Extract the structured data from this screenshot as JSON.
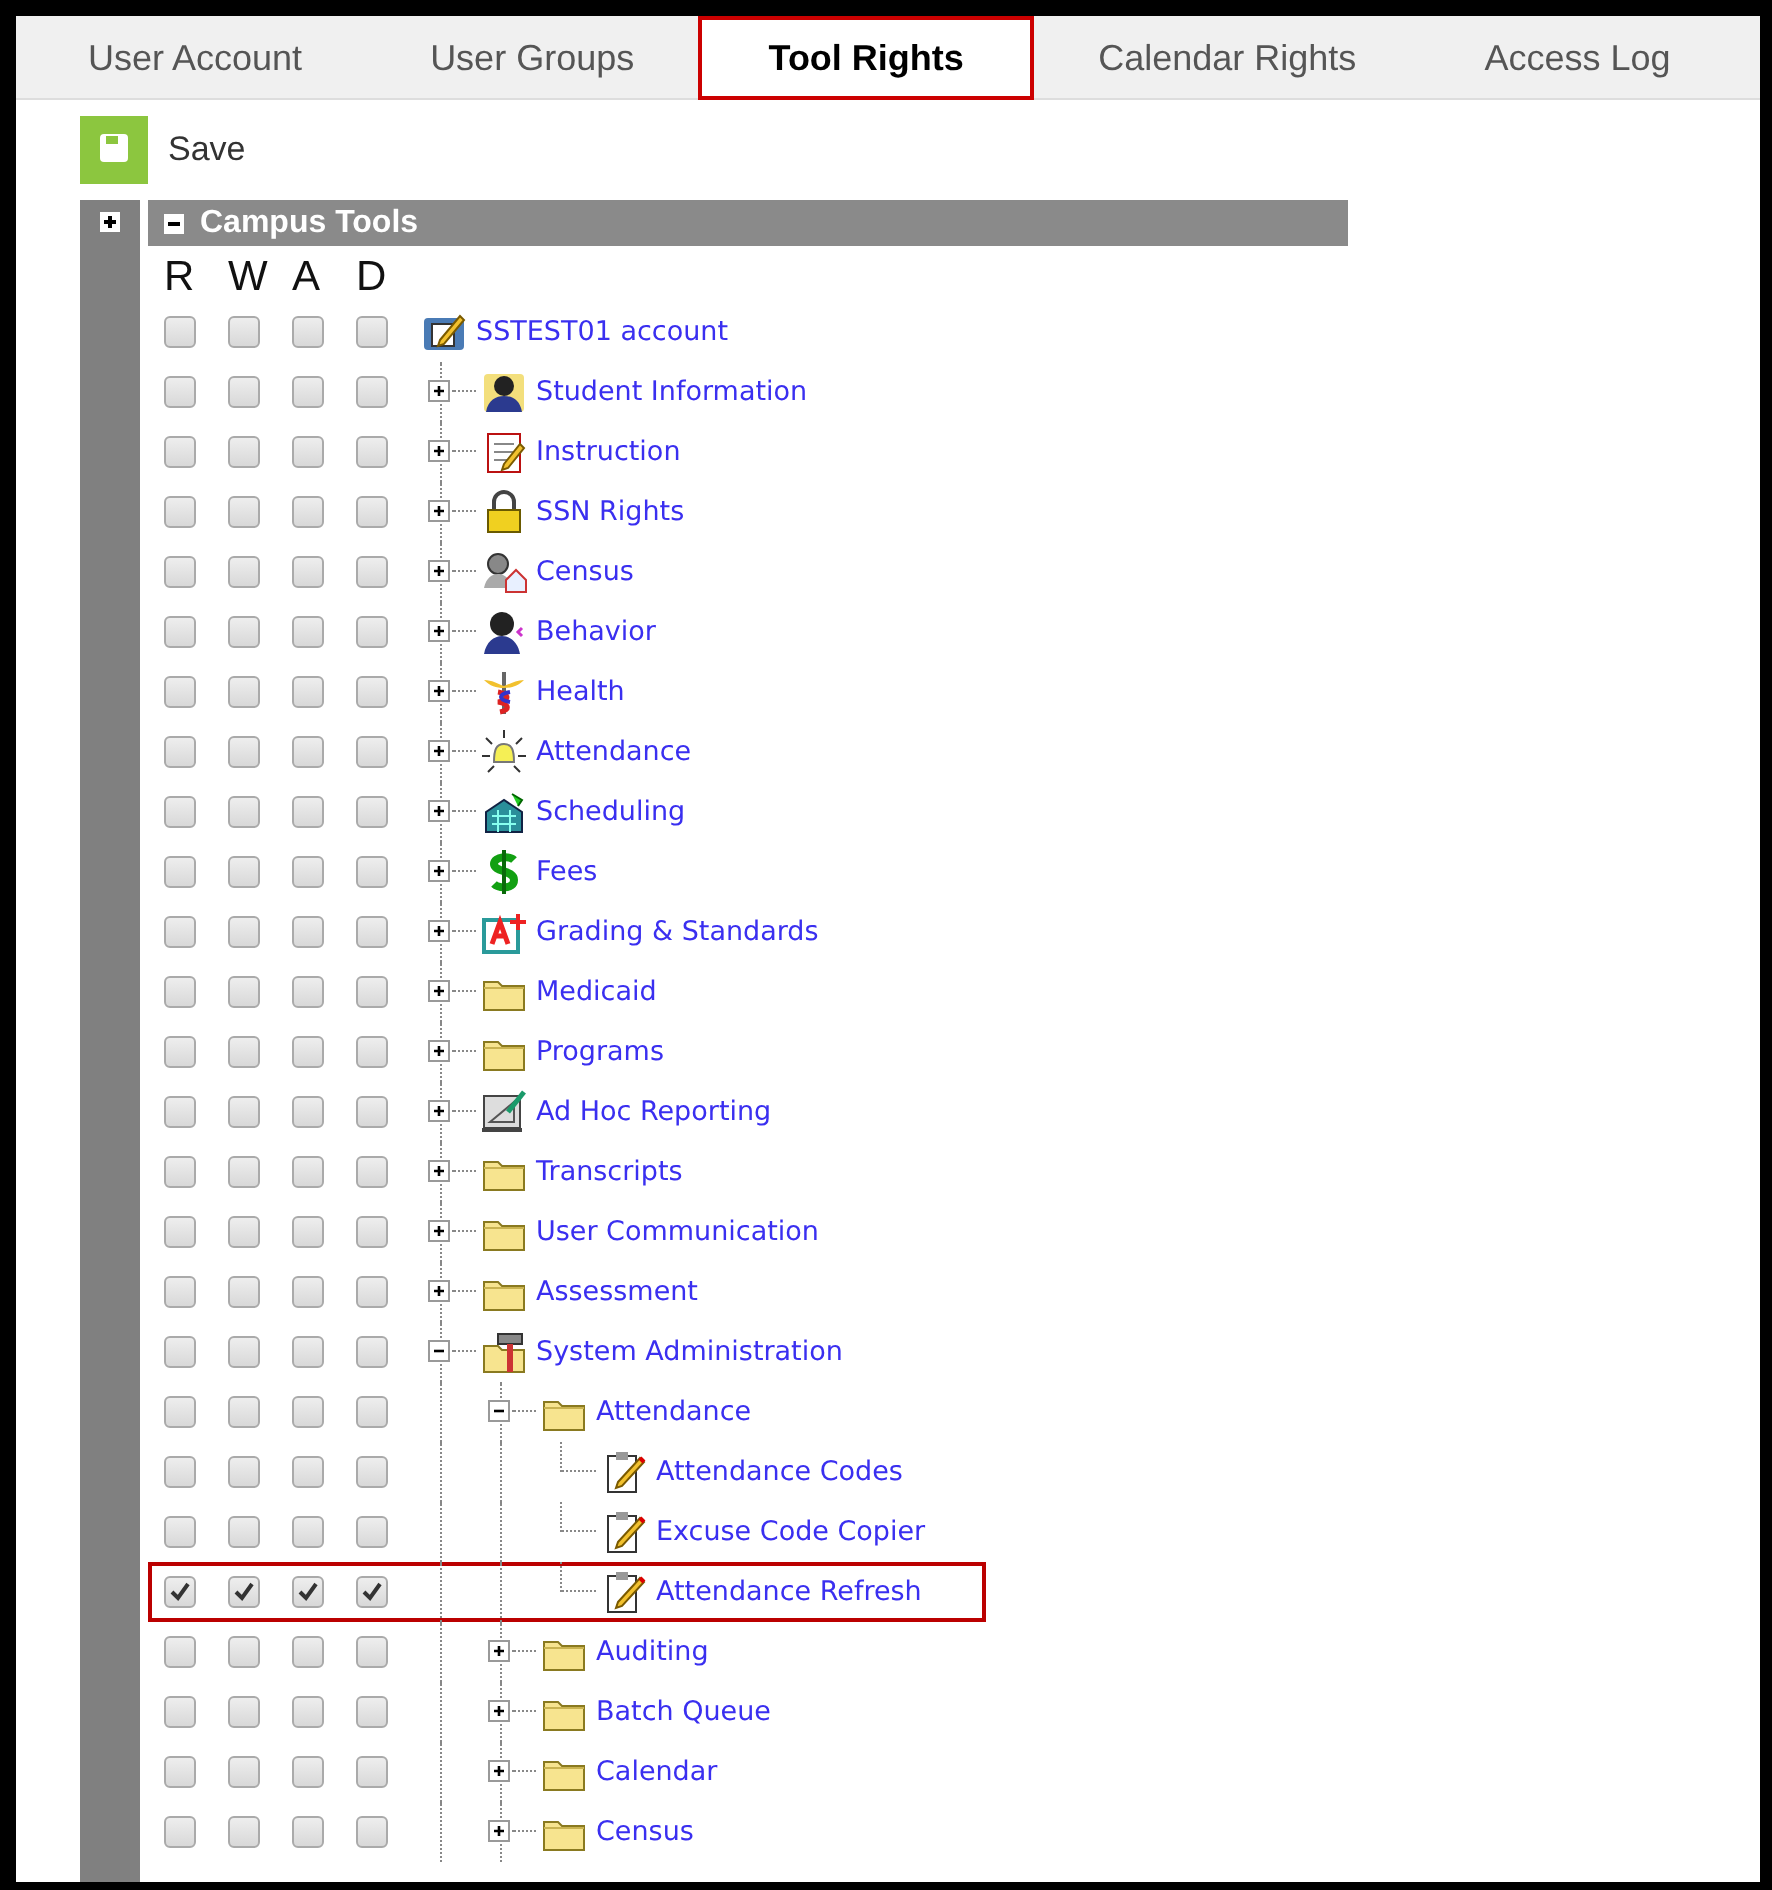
{
  "tabs": [
    {
      "label": "User Account",
      "selected": false
    },
    {
      "label": "User Groups",
      "selected": false
    },
    {
      "label": "Tool Rights",
      "selected": true
    },
    {
      "label": "Calendar Rights",
      "selected": false
    },
    {
      "label": "Access Log",
      "selected": false
    }
  ],
  "toolbar": {
    "save_label": "Save"
  },
  "panel": {
    "title": "Campus Tools",
    "expanded": true
  },
  "columns": [
    "R",
    "W",
    "A",
    "D"
  ],
  "account": {
    "label": "SSTEST01 account",
    "kind": "account",
    "rights": [
      false,
      false,
      false,
      false
    ],
    "highlighted": false,
    "children": [
      {
        "label": "Student Information",
        "kind": "student",
        "expanded": false,
        "rights": [
          false,
          false,
          false,
          false
        ],
        "highlighted": false
      },
      {
        "label": "Instruction",
        "kind": "instruction",
        "expanded": false,
        "rights": [
          false,
          false,
          false,
          false
        ],
        "highlighted": false
      },
      {
        "label": "SSN Rights",
        "kind": "lock",
        "expanded": false,
        "rights": [
          false,
          false,
          false,
          false
        ],
        "highlighted": false
      },
      {
        "label": "Census",
        "kind": "census",
        "expanded": false,
        "rights": [
          false,
          false,
          false,
          false
        ],
        "highlighted": false
      },
      {
        "label": "Behavior",
        "kind": "behavior",
        "expanded": false,
        "rights": [
          false,
          false,
          false,
          false
        ],
        "highlighted": false
      },
      {
        "label": "Health",
        "kind": "health",
        "expanded": false,
        "rights": [
          false,
          false,
          false,
          false
        ],
        "highlighted": false
      },
      {
        "label": "Attendance",
        "kind": "bell",
        "expanded": false,
        "rights": [
          false,
          false,
          false,
          false
        ],
        "highlighted": false
      },
      {
        "label": "Scheduling",
        "kind": "scheduling",
        "expanded": false,
        "rights": [
          false,
          false,
          false,
          false
        ],
        "highlighted": false
      },
      {
        "label": "Fees",
        "kind": "fees",
        "expanded": false,
        "rights": [
          false,
          false,
          false,
          false
        ],
        "highlighted": false
      },
      {
        "label": "Grading & Standards",
        "kind": "grading",
        "expanded": false,
        "rights": [
          false,
          false,
          false,
          false
        ],
        "highlighted": false
      },
      {
        "label": "Medicaid",
        "kind": "folder",
        "expanded": false,
        "rights": [
          false,
          false,
          false,
          false
        ],
        "highlighted": false
      },
      {
        "label": "Programs",
        "kind": "folder",
        "expanded": false,
        "rights": [
          false,
          false,
          false,
          false
        ],
        "highlighted": false
      },
      {
        "label": "Ad Hoc Reporting",
        "kind": "report",
        "expanded": false,
        "rights": [
          false,
          false,
          false,
          false
        ],
        "highlighted": false
      },
      {
        "label": "Transcripts",
        "kind": "folder",
        "expanded": false,
        "rights": [
          false,
          false,
          false,
          false
        ],
        "highlighted": false
      },
      {
        "label": "User Communication",
        "kind": "folder",
        "expanded": false,
        "rights": [
          false,
          false,
          false,
          false
        ],
        "highlighted": false
      },
      {
        "label": "Assessment",
        "kind": "folder",
        "expanded": false,
        "rights": [
          false,
          false,
          false,
          false
        ],
        "highlighted": false
      },
      {
        "label": "System Administration",
        "kind": "admin",
        "expanded": true,
        "rights": [
          false,
          false,
          false,
          false
        ],
        "highlighted": false,
        "children": [
          {
            "label": "Attendance",
            "kind": "folder",
            "expanded": true,
            "rights": [
              false,
              false,
              false,
              false
            ],
            "highlighted": false,
            "children": [
              {
                "label": "Attendance Codes",
                "kind": "page",
                "rights": [
                  false,
                  false,
                  false,
                  false
                ],
                "highlighted": false
              },
              {
                "label": "Excuse Code Copier",
                "kind": "page",
                "rights": [
                  false,
                  false,
                  false,
                  false
                ],
                "highlighted": false
              },
              {
                "label": "Attendance Refresh",
                "kind": "page",
                "rights": [
                  true,
                  true,
                  true,
                  true
                ],
                "highlighted": true
              }
            ]
          },
          {
            "label": "Auditing",
            "kind": "folder",
            "expanded": false,
            "rights": [
              false,
              false,
              false,
              false
            ],
            "highlighted": false
          },
          {
            "label": "Batch Queue",
            "kind": "folder",
            "expanded": false,
            "rights": [
              false,
              false,
              false,
              false
            ],
            "highlighted": false
          },
          {
            "label": "Calendar",
            "kind": "folder",
            "expanded": false,
            "rights": [
              false,
              false,
              false,
              false
            ],
            "highlighted": false
          },
          {
            "label": "Census",
            "kind": "folder",
            "expanded": false,
            "rights": [
              false,
              false,
              false,
              false
            ],
            "highlighted": false
          }
        ]
      }
    ]
  }
}
